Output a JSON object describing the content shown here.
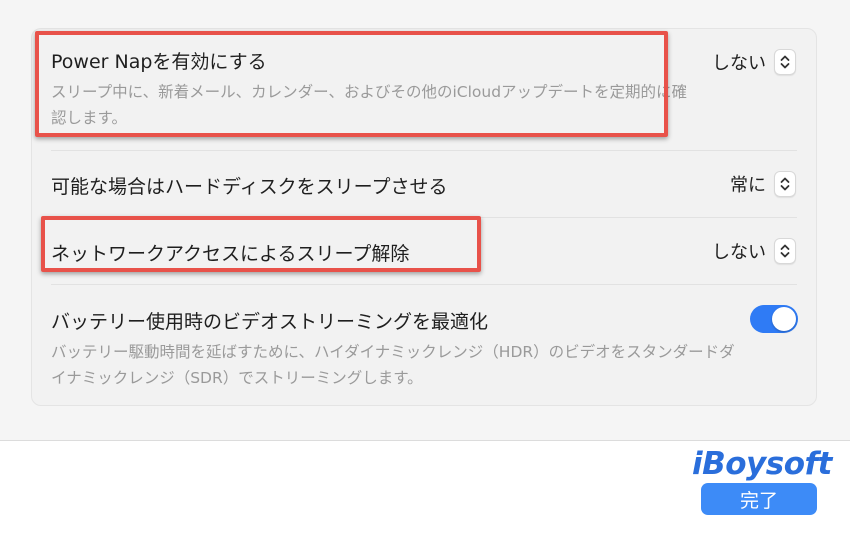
{
  "settings": {
    "power_nap": {
      "title": "Power Napを有効にする",
      "description": "スリープ中に、新着メール、カレンダー、およびその他のiCloudアップデートを定期的に確認します。",
      "value": "しない"
    },
    "hard_disk_sleep": {
      "title": "可能な場合はハードディスクをスリープさせる",
      "value": "常に"
    },
    "network_wake": {
      "title": "ネットワークアクセスによるスリープ解除",
      "value": "しない"
    },
    "battery_video": {
      "title": "バッテリー使用時のビデオストリーミングを最適化",
      "description": "バッテリー駆動時間を延ばすために、ハイダイナミックレンジ（HDR）のビデオをスタンダードダイナミックレンジ（SDR）でストリーミングします。",
      "enabled": true
    }
  },
  "footer": {
    "done_label": "完了"
  },
  "colors": {
    "accent": "#2f7bf5",
    "highlight": "#e8524a"
  },
  "watermark": "iBoysoft"
}
